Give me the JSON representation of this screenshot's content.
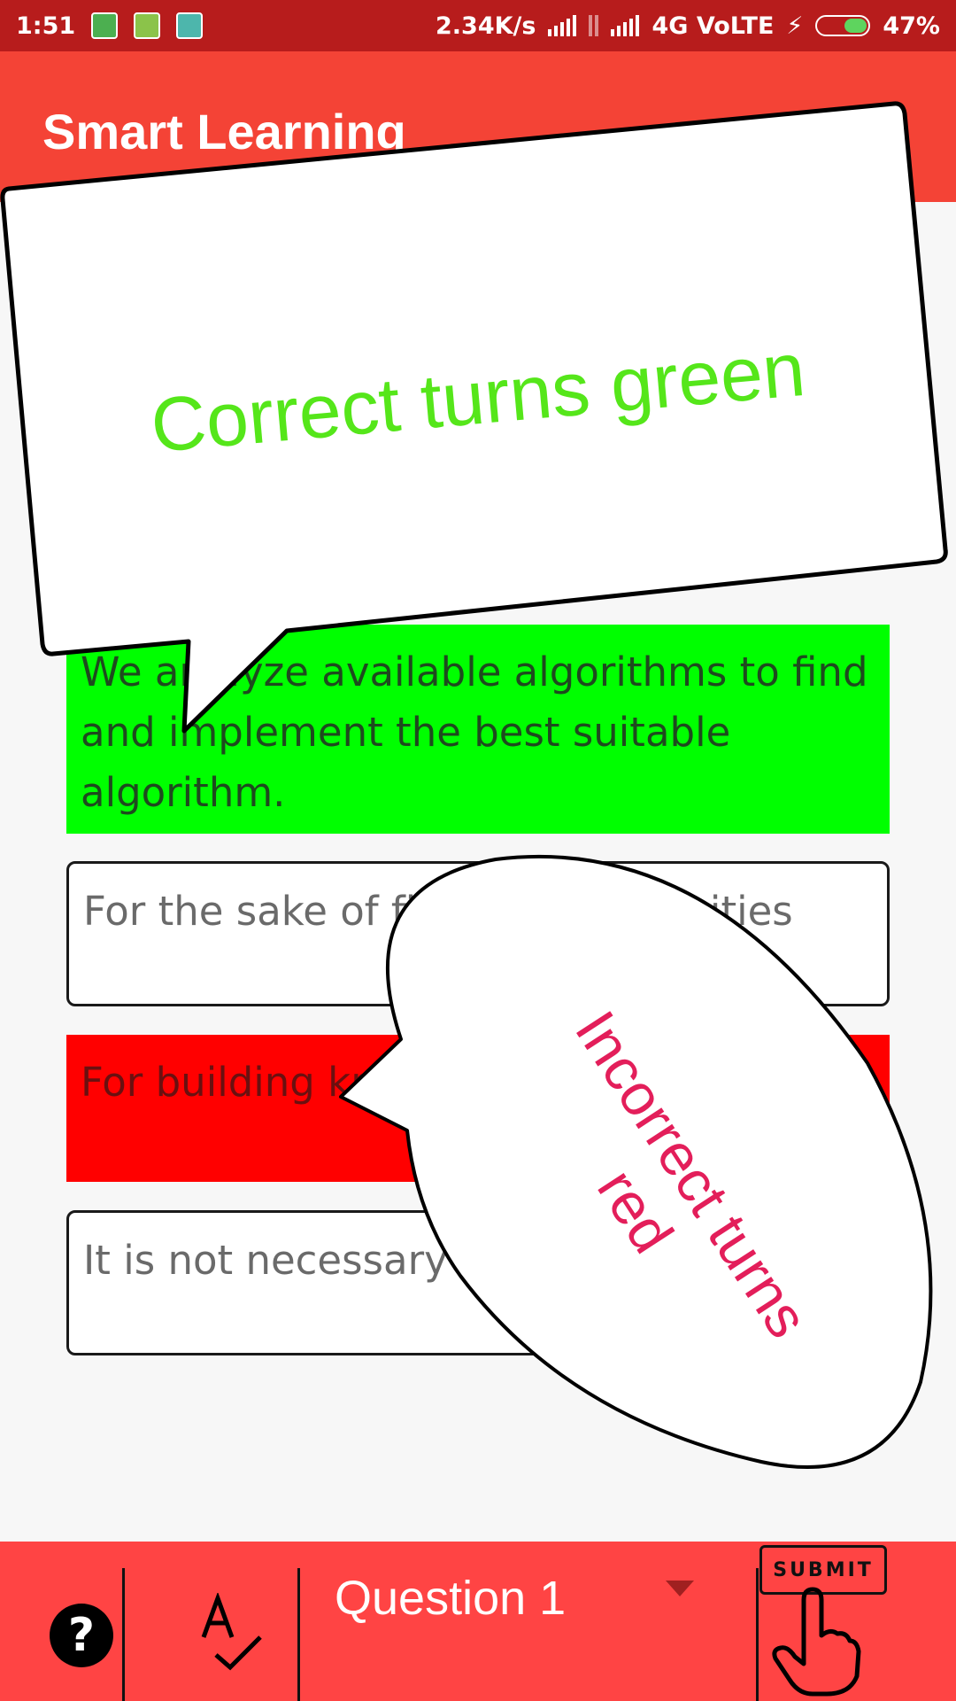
{
  "status_bar": {
    "time": "1:51",
    "net_speed": "2.34K/s",
    "network": "4G VoLTE",
    "battery": "47%",
    "battery_level": 0.47
  },
  "app_bar": {
    "title": "Smart Learning"
  },
  "options": [
    {
      "text": "We analyze available algorithms to find and implement the best suitable algorithm.",
      "state": "correct",
      "color": "#00ff00"
    },
    {
      "text": "For the sake of finding complexities",
      "state": "neutral"
    },
    {
      "text": "For building knowledge of algorithms",
      "state": "incorrect",
      "color": "#ff0000"
    },
    {
      "text": "It is not necessary to do analysis",
      "state": "neutral"
    }
  ],
  "callouts": {
    "green": {
      "text": "Correct turns green",
      "color": "#55e61a"
    },
    "red": {
      "text": "Incorrect turns red",
      "color": "#e31e5a"
    }
  },
  "bottom_bar": {
    "help_icon": "question-icon",
    "help_label": "?",
    "spell_icon": "spellcheck-icon",
    "question_selected": "Question 1",
    "submit_label": "SUBMIT",
    "submit_icon": "hand-pointer-icon",
    "accent": "#ff4444"
  }
}
